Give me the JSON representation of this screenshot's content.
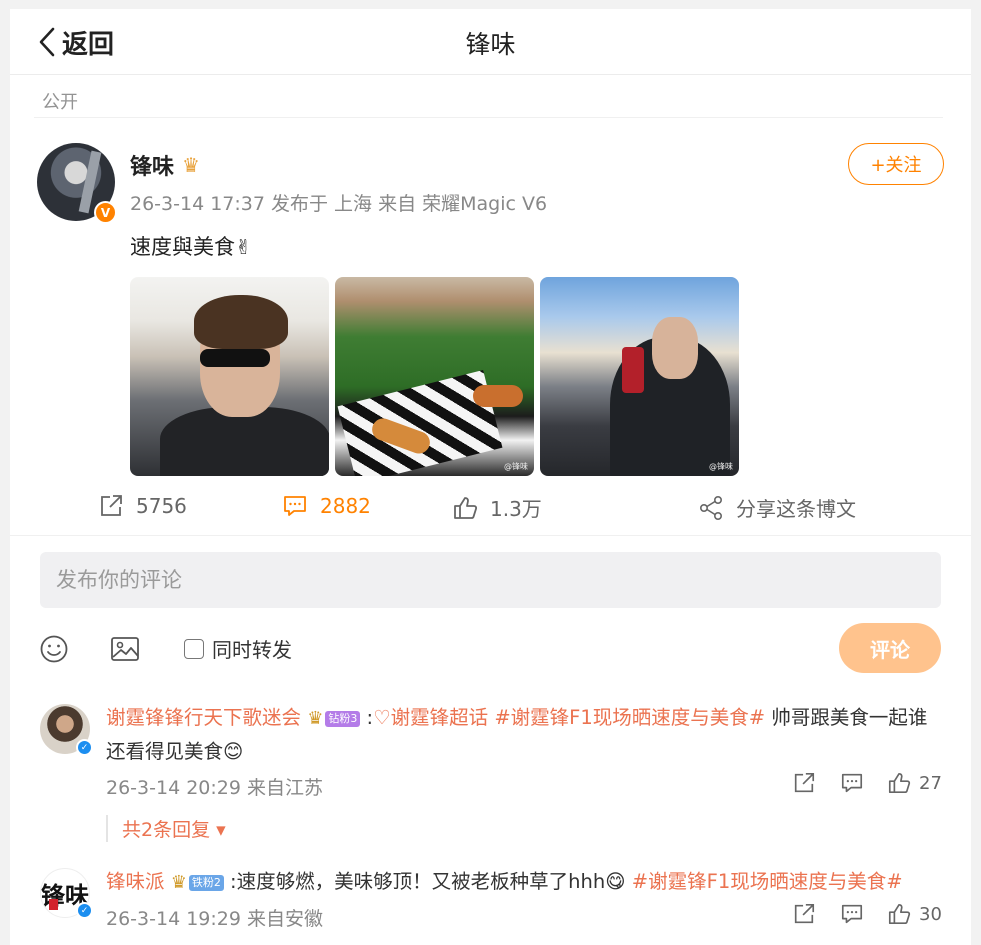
{
  "header": {
    "back_label": "返回",
    "title": "锋味"
  },
  "post": {
    "visibility": "公开",
    "author": "锋味",
    "meta": "26-3-14 17:37 发布于 上海 来自 荣耀Magic V6",
    "follow_label": "+关注",
    "text": "速度與美食",
    "text_emoji": "✌",
    "watermark": "@锋味",
    "actions": {
      "repost": "5756",
      "comment": "2882",
      "like": "1.3万",
      "share": "分享这条博文"
    },
    "accent_color": "#ff8200"
  },
  "composer": {
    "placeholder": "发布你的评论",
    "emoji_icon": "smile-icon",
    "image_icon": "image-icon",
    "repost_label": "同时转发",
    "submit_label": "评论"
  },
  "comments": [
    {
      "user": "谢霆锋锋行天下歌迷会",
      "badge": "钻粉3",
      "topic_super": "谢霆锋超话",
      "hashtag": "#谢霆锋F1现场晒速度与美食#",
      "text": "帅哥跟美食一起谁还看得见美食",
      "emoji": "😊",
      "meta": "26-3-14 20:29 来自江苏",
      "likes": "27",
      "replies_label": "共2条回复"
    },
    {
      "user": "锋味派",
      "badge": "铁粉2",
      "text": "速度够燃，美味够顶！又被老板种草了hhh",
      "emoji": "😋",
      "hashtag": "#谢霆锋F1现场晒速度与美食#",
      "meta": "26-3-14 19:29 来自安徽",
      "likes": "30"
    }
  ]
}
